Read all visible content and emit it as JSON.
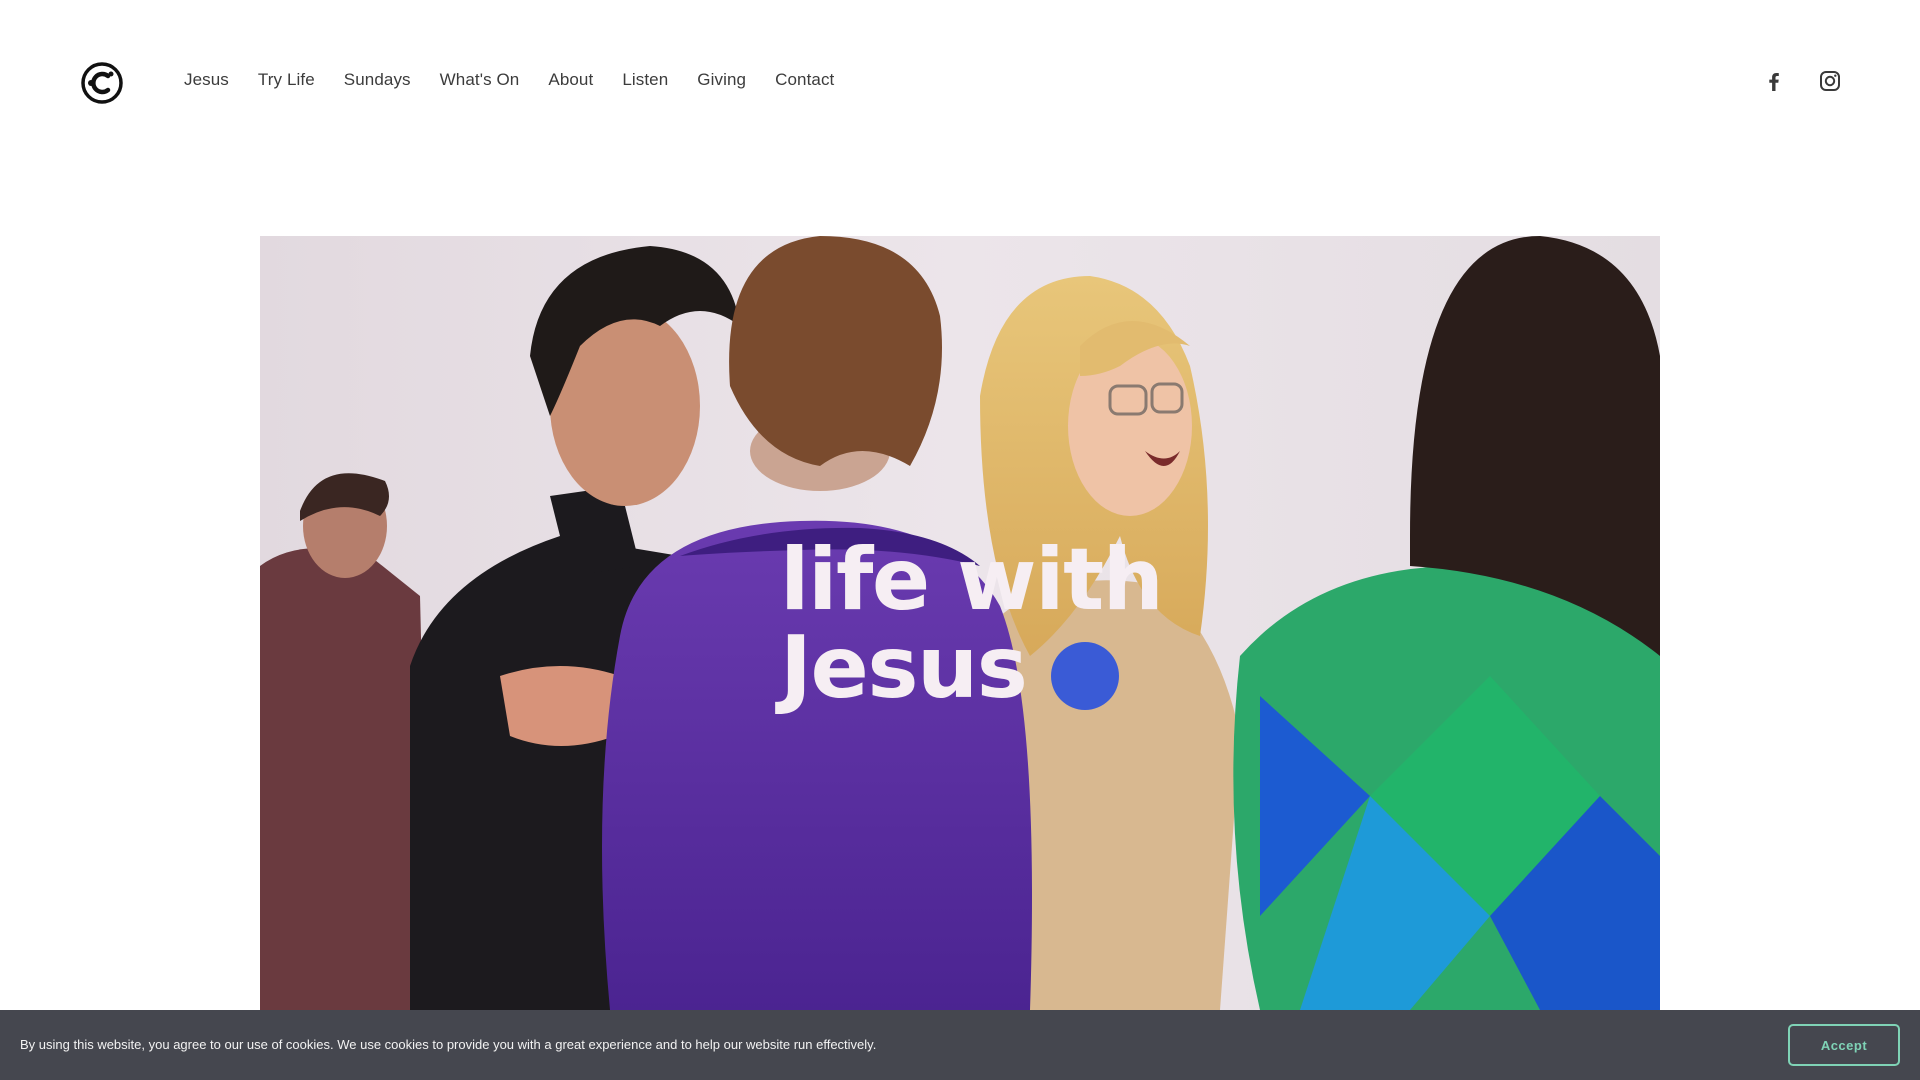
{
  "nav": {
    "items": [
      {
        "label": "Jesus"
      },
      {
        "label": "Try Life"
      },
      {
        "label": "Sundays"
      },
      {
        "label": "What's On"
      },
      {
        "label": "About"
      },
      {
        "label": "Listen"
      },
      {
        "label": "Giving"
      },
      {
        "label": "Contact"
      }
    ]
  },
  "social": {
    "icons": [
      "facebook-icon",
      "instagram-icon"
    ]
  },
  "hero": {
    "line1": "life with",
    "line2": "Jesus",
    "dot_color": "#3a5bd6"
  },
  "cookie": {
    "message": "By using this website, you agree to our use of cookies. We use cookies to provide you with a great experience and to help our website run effectively.",
    "accept_label": "Accept",
    "accent_color": "#7fd3b6"
  }
}
